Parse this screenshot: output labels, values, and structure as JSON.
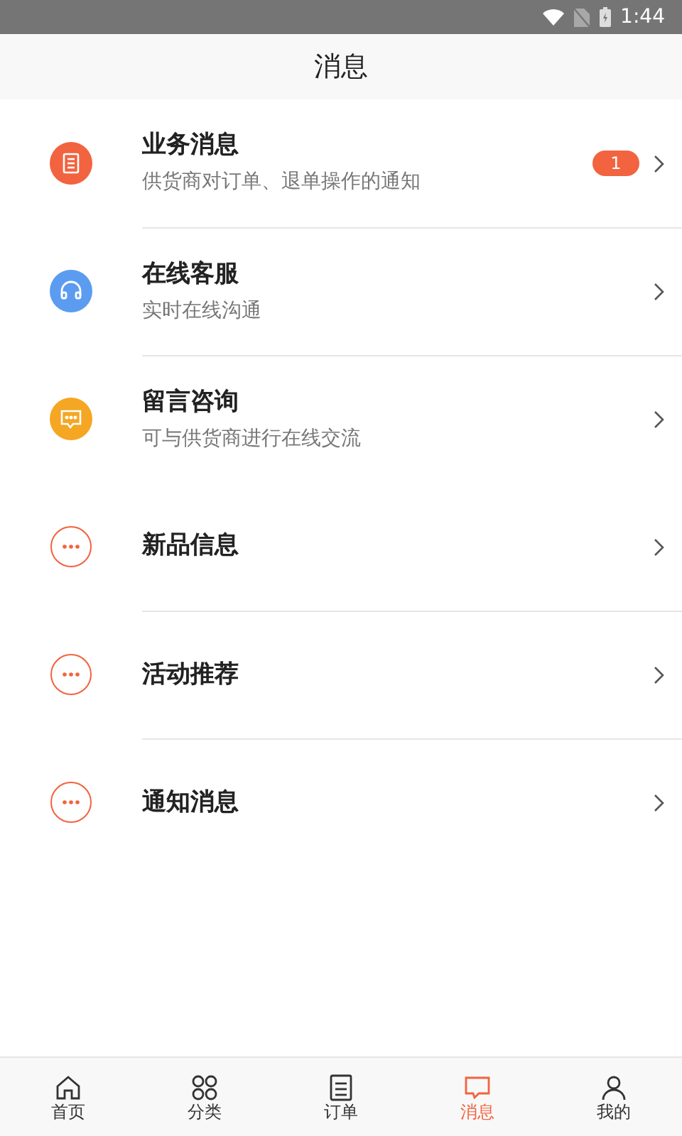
{
  "status_bar": {
    "time": "1:44"
  },
  "header": {
    "title": "消息"
  },
  "sections": [
    {
      "items": [
        {
          "kind": "list",
          "color": "#f2633f",
          "title": "业务消息",
          "subtitle": "供货商对订单、退单操作的通知",
          "badge": "1"
        },
        {
          "kind": "headset",
          "color": "#5b9cf0",
          "title": "在线客服",
          "subtitle": "实时在线沟通"
        },
        {
          "kind": "chat",
          "color": "#f5a623",
          "title": "留言咨询",
          "subtitle": "可与供货商进行在线交流"
        }
      ]
    },
    {
      "items": [
        {
          "kind": "more",
          "color": "#f2633f",
          "title": "新品信息"
        },
        {
          "kind": "more",
          "color": "#f2633f",
          "title": "活动推荐"
        },
        {
          "kind": "more",
          "color": "#f2633f",
          "title": "通知消息"
        }
      ]
    }
  ],
  "tabs": [
    {
      "kind": "home",
      "label": "首页",
      "selected": false
    },
    {
      "kind": "grid",
      "label": "分类",
      "selected": false
    },
    {
      "kind": "order",
      "label": "订单",
      "selected": false
    },
    {
      "kind": "message",
      "label": "消息",
      "selected": true
    },
    {
      "kind": "user",
      "label": "我的",
      "selected": false
    }
  ]
}
